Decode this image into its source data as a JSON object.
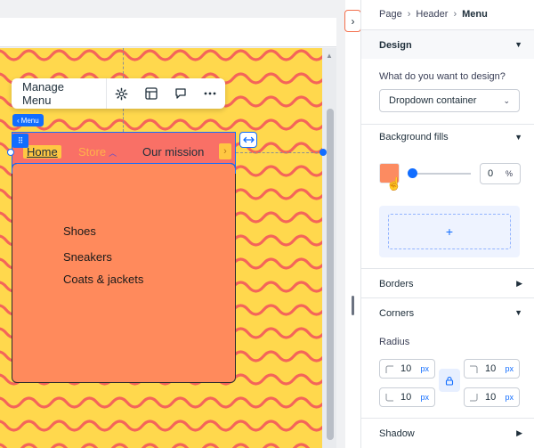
{
  "canvas": {
    "toolbar": {
      "manage_menu_label": "Manage Menu"
    },
    "menu_tag": "Menu",
    "menubar": {
      "items": [
        "Home",
        "Store",
        "Our mission"
      ]
    },
    "dropdown": {
      "items": [
        "Shoes",
        "Sneakers",
        "Coats & jackets"
      ]
    },
    "colors": {
      "pattern_bg": "#ffd84d",
      "wave": "#f4645a",
      "menubar_bg": "#f97066",
      "dropdown_bg": "#ff8a5c",
      "selection": "#116dff"
    }
  },
  "panel": {
    "breadcrumb": [
      "Page",
      "Header",
      "Menu"
    ],
    "design_title": "Design",
    "design_question": "What do you want to design?",
    "design_select_value": "Dropdown container",
    "background_fills_title": "Background fills",
    "fill_color": "#fc8b61",
    "opacity_value": "0",
    "opacity_unit": "%",
    "add_fill_symbol": "+",
    "borders_title": "Borders",
    "corners_title": "Corners",
    "radius_label": "Radius",
    "corners": [
      {
        "value": "10",
        "unit": "px"
      },
      {
        "value": "10",
        "unit": "px"
      },
      {
        "value": "10",
        "unit": "px"
      },
      {
        "value": "10",
        "unit": "px"
      }
    ],
    "shadow_title": "Shadow"
  }
}
